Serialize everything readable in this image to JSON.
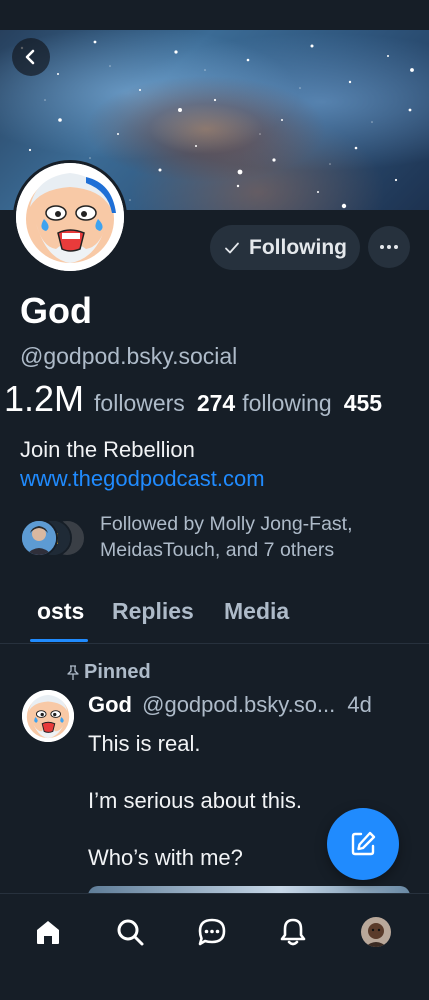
{
  "profile": {
    "display_name": "God",
    "handle": "@godpod.bsky.social",
    "followers_count": "1.2M",
    "followers_label": "followers",
    "following_count": "274",
    "following_label": "following",
    "posts_count": "455",
    "bio": "Join the Rebellion",
    "link": "www.thegodpodcast.com",
    "followed_by": "Followed by Molly Jong-Fast, MeidasTouch, and 7 others"
  },
  "actions": {
    "following_label": "Following",
    "more_label": "···"
  },
  "tabs": [
    {
      "label": "osts",
      "active": true
    },
    {
      "label": "Replies",
      "active": false
    },
    {
      "label": "Media",
      "active": false
    }
  ],
  "post": {
    "pinned_label": "Pinned",
    "author": "God",
    "handle": "@godpod.bsky.so...",
    "time": "4d",
    "lines": [
      "This is real.",
      "I’m serious about this.",
      "Who’s with me?"
    ]
  },
  "nav": {
    "items": [
      "home-icon",
      "search-icon",
      "chat-icon",
      "bell-icon",
      "profile-avatar"
    ]
  },
  "colors": {
    "background": "#161e27",
    "accent": "#208bfe",
    "muted_text": "#aebbc9",
    "button_bg": "#26313d"
  }
}
